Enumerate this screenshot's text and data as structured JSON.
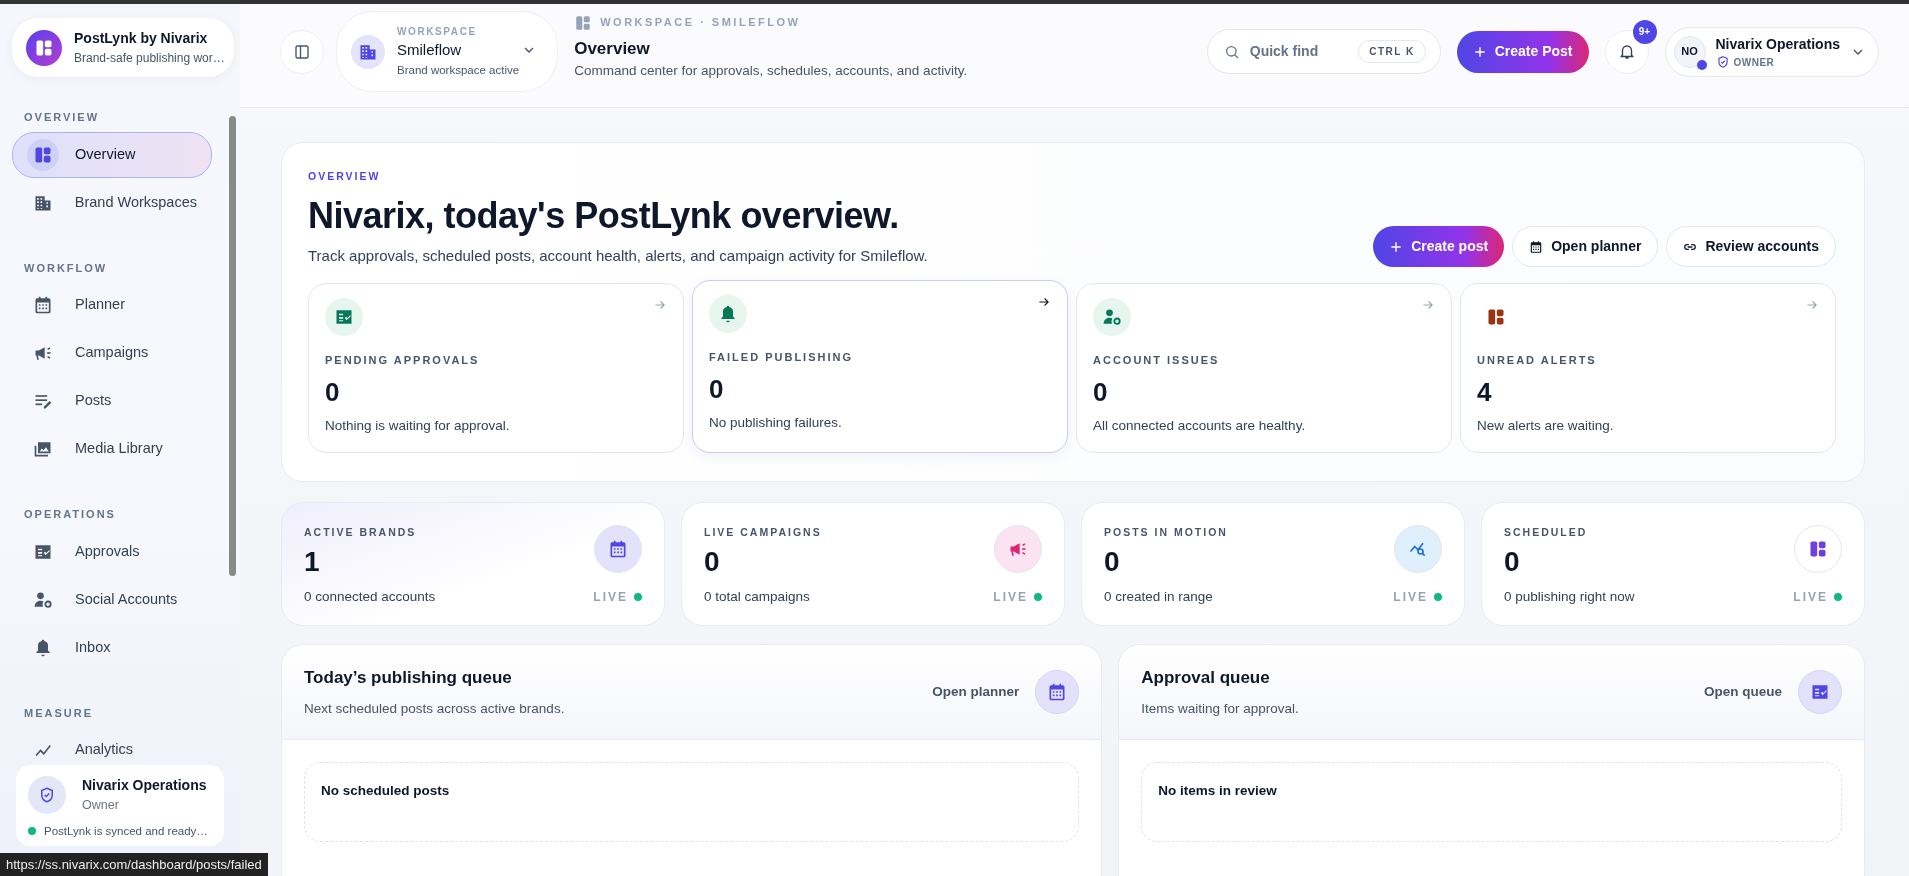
{
  "sidebar": {
    "brand": {
      "name": "PostLynk by Nivarix",
      "tagline": "Brand-safe publishing wor…"
    },
    "sections": [
      {
        "title": "OVERVIEW",
        "items": [
          {
            "label": "Overview",
            "selected": true
          },
          {
            "label": "Brand Workspaces",
            "selected": false
          }
        ]
      },
      {
        "title": "WORKFLOW",
        "items": [
          {
            "label": "Planner",
            "selected": false
          },
          {
            "label": "Campaigns",
            "selected": false
          },
          {
            "label": "Posts",
            "selected": false
          },
          {
            "label": "Media Library",
            "selected": false
          }
        ]
      },
      {
        "title": "OPERATIONS",
        "items": [
          {
            "label": "Approvals",
            "selected": false
          },
          {
            "label": "Social Accounts",
            "selected": false
          },
          {
            "label": "Inbox",
            "selected": false
          }
        ]
      },
      {
        "title": "MEASURE",
        "items": [
          {
            "label": "Analytics",
            "selected": false
          }
        ]
      }
    ],
    "footer": {
      "name": "Nivarix Operations",
      "role": "Owner",
      "status": "PostLynk is synced and ready…"
    }
  },
  "header": {
    "workspace": {
      "label": "WORKSPACE",
      "name": "Smileflow",
      "status": "Brand workspace active"
    },
    "breadcrumb": "WORKSPACE · SMILEFLOW",
    "title": "Overview",
    "subtitle": "Command center for approvals, schedules, accounts, and activity.",
    "quick_find": {
      "placeholder": "Quick find",
      "shortcut": "CTRL K"
    },
    "create_button": "Create Post",
    "notifications": {
      "badge": "9+"
    },
    "user": {
      "initials": "NO",
      "name": "Nivarix Operations",
      "role": "OWNER"
    }
  },
  "overview": {
    "eyebrow": "OVERVIEW",
    "title": "Nivarix, today's PostLynk overview.",
    "subtitle": "Track approvals, scheduled posts, account health, alerts, and campaign activity for Smileflow.",
    "actions": [
      {
        "label": "Create post",
        "kind": "primary"
      },
      {
        "label": "Open planner",
        "kind": "outline"
      },
      {
        "label": "Review accounts",
        "kind": "outline"
      }
    ],
    "tiles": [
      {
        "label": "PENDING APPROVALS",
        "value": "0",
        "note": "Nothing is waiting for approval.",
        "hovered": false
      },
      {
        "label": "FAILED PUBLISHING",
        "value": "0",
        "note": "No publishing failures.",
        "hovered": true
      },
      {
        "label": "ACCOUNT ISSUES",
        "value": "0",
        "note": "All connected accounts are healthy.",
        "hovered": false
      },
      {
        "label": "UNREAD ALERTS",
        "value": "4",
        "note": "New alerts are waiting.",
        "hovered": false
      }
    ]
  },
  "stats": [
    {
      "label": "ACTIVE BRANDS",
      "value": "1",
      "note": "0 connected accounts",
      "status": "LIVE"
    },
    {
      "label": "LIVE CAMPAIGNS",
      "value": "0",
      "note": "0 total campaigns",
      "status": "LIVE"
    },
    {
      "label": "POSTS IN MOTION",
      "value": "0",
      "note": "0 created in range",
      "status": "LIVE"
    },
    {
      "label": "SCHEDULED",
      "value": "0",
      "note": "0 publishing right now",
      "status": "LIVE"
    }
  ],
  "queues": [
    {
      "title": "Today’s publishing queue",
      "subtitle": "Next scheduled posts across active brands.",
      "link": "Open planner",
      "empty_title": "No scheduled posts"
    },
    {
      "title": "Approval queue",
      "subtitle": "Items waiting for approval.",
      "link": "Open queue",
      "empty_title": "No items in review"
    }
  ],
  "status_url": "https://ss.nivarix.com/dashboard/posts/failed"
}
